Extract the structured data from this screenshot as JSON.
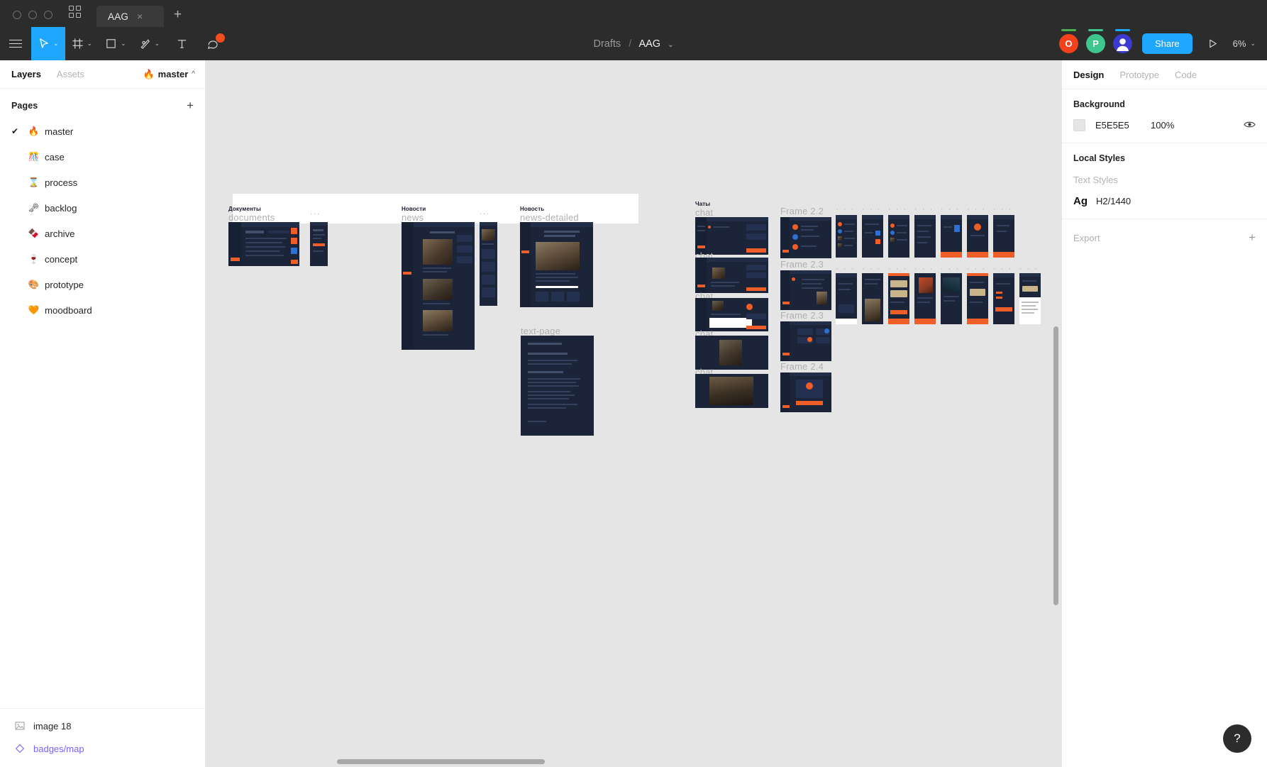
{
  "window": {
    "traffic_lights": [
      "close",
      "minimize",
      "maximize"
    ],
    "grid_icon": "grid-icon",
    "tab": {
      "name": "AAG",
      "close": "×"
    },
    "new_tab": "+"
  },
  "toolbar": {
    "menu_icon": "hamburger-menu-icon",
    "tools": [
      {
        "name": "move-tool",
        "icon": "cursor-icon",
        "caret": "⌄",
        "active": true
      },
      {
        "name": "frame-tool",
        "icon": "frame-icon",
        "caret": "⌄",
        "active": false
      },
      {
        "name": "shape-tool",
        "icon": "square-icon",
        "caret": "⌄",
        "active": false
      },
      {
        "name": "pen-tool",
        "icon": "pen-icon",
        "caret": "⌄",
        "active": false
      },
      {
        "name": "text-tool",
        "icon": "text-icon",
        "caret": "",
        "active": false
      },
      {
        "name": "comment-tool",
        "icon": "comment-icon",
        "caret": "",
        "active": false,
        "badge": true
      }
    ],
    "breadcrumb": {
      "project": "Drafts",
      "separator": "/",
      "file": "AAG",
      "caret": "⌄"
    },
    "avatars": [
      {
        "initial": "O",
        "color": "#f2411b",
        "bar": "#4caf50"
      },
      {
        "initial": "P",
        "color": "#3ec78d",
        "bar": "#3ec78d"
      },
      {
        "initial": "",
        "color": "#3a3ad0",
        "bar": "#1ea7fd",
        "icon": "person-avatar-icon"
      }
    ],
    "share_label": "Share",
    "present_icon": "play-icon",
    "zoom_level": "6%",
    "zoom_caret": "⌄"
  },
  "left_panel": {
    "tabs": [
      {
        "label": "Layers",
        "selected": true
      },
      {
        "label": "Assets",
        "selected": false
      }
    ],
    "current_page": {
      "emoji": "🔥",
      "label": "master",
      "caret": "^"
    },
    "pages_header": {
      "title": "Pages",
      "add": "+"
    },
    "pages": [
      {
        "emoji": "🔥",
        "label": "master",
        "selected": true,
        "check": "✔"
      },
      {
        "emoji": "🎊",
        "label": "case",
        "selected": false,
        "check": ""
      },
      {
        "emoji": "⌛",
        "label": "process",
        "selected": false,
        "check": ""
      },
      {
        "emoji": "🗝",
        "label": "backlog",
        "selected": false,
        "check": ""
      },
      {
        "emoji": "🍫",
        "label": "archive",
        "selected": false,
        "check": ""
      },
      {
        "emoji": "🍷",
        "label": "concept",
        "selected": false,
        "check": ""
      },
      {
        "emoji": "🎨",
        "label": "prototype",
        "selected": false,
        "check": ""
      },
      {
        "emoji": "🧡",
        "label": "moodboard",
        "selected": false,
        "check": ""
      }
    ],
    "layers": [
      {
        "icon": "image-icon",
        "label": "image 18",
        "type": "image"
      },
      {
        "icon": "component-icon",
        "label": "badges/map",
        "type": "component"
      }
    ]
  },
  "right_panel": {
    "tabs": [
      {
        "label": "Design",
        "selected": true
      },
      {
        "label": "Prototype",
        "selected": false
      },
      {
        "label": "Code",
        "selected": false
      }
    ],
    "background": {
      "title": "Background",
      "hex": "E5E5E5",
      "opacity": "100%",
      "visibility_icon": "eye-icon"
    },
    "local_styles": {
      "title": "Local Styles",
      "subtitle": "Text Styles",
      "text_style": {
        "preview": "Ag",
        "name": "H2/1440"
      }
    },
    "export": {
      "label": "Export",
      "add": "+"
    }
  },
  "canvas": {
    "background_color": "#E5E5E5",
    "frames": [
      {
        "id": "documents",
        "ru": "Документы",
        "en": "documents"
      },
      {
        "id": "documents-side",
        "ru": "",
        "en": "..."
      },
      {
        "id": "news",
        "ru": "Новости",
        "en": "news"
      },
      {
        "id": "news-side",
        "ru": "",
        "en": "..."
      },
      {
        "id": "news-detailed",
        "ru": "Новость",
        "en": "news-detailed"
      },
      {
        "id": "text-page",
        "ru": "",
        "en": "text-page"
      },
      {
        "id": "chat",
        "ru": "Чаты",
        "en": "chat"
      },
      {
        "id": "chat-2",
        "ru": "",
        "en": "chat"
      },
      {
        "id": "chat-3",
        "ru": "",
        "en": "chat"
      },
      {
        "id": "chat-4",
        "ru": "",
        "en": "chat"
      },
      {
        "id": "chat-5",
        "ru": "",
        "en": "chat"
      },
      {
        "id": "frame-2-2",
        "ru": "",
        "en": "Frame 2.2"
      },
      {
        "id": "frame-2-3a",
        "ru": "",
        "en": "Frame 2.3"
      },
      {
        "id": "frame-2-3b",
        "ru": "",
        "en": "Frame 2.3"
      },
      {
        "id": "frame-2-4",
        "ru": "",
        "en": "Frame 2.4"
      }
    ],
    "mobile_labels": "· · ·",
    "help_button": "?"
  }
}
